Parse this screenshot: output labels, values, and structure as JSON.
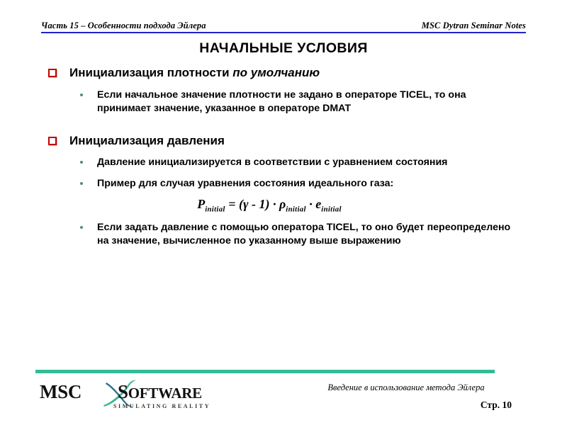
{
  "header": {
    "left": "Часть 15 – Особенности подхода Эйлера",
    "right": "MSC Dytran Seminar Notes",
    "rule_color": "#2222cc"
  },
  "title": "НАЧАЛЬНЫЕ УСЛОВИЯ",
  "bullets": {
    "b1": {
      "text_plain": "Инициализация плотности ",
      "text_italic": "по умолчанию",
      "marker_color": "#c00000",
      "sub": [
        {
          "text": "Если начальное значение плотности не задано в операторе TICEL, то она принимает значение, указанное в операторе DMAT"
        }
      ]
    },
    "b2": {
      "text_plain": "Инициализация давления",
      "text_italic": "",
      "marker_color": "#c00000",
      "sub": [
        {
          "text": "Давление инициализируется в соответствии с уравнением состояния"
        },
        {
          "text": "Пример для случая уравнения состояния идеального газа:"
        },
        {
          "text": "Если задать давление с помощью оператора TICEL, то оно будет переопределено на значение, вычисленное по указанному выше выражению"
        }
      ]
    }
  },
  "formula": {
    "lhs_var": "P",
    "lhs_sub": "initial",
    "equals": " = (",
    "gamma": "γ",
    "minus_one": " - 1) · ",
    "rho": "ρ",
    "rho_sub": "initial",
    "dot": " · ",
    "e_var": "e",
    "e_sub": "initial",
    "full": "P initial = (γ - 1) · ρ initial · e initial"
  },
  "footer": {
    "rule_color": "#33bb99",
    "logo_msc": "MSC",
    "logo_software_cap": "S",
    "logo_software_rest": "OFTWARE",
    "logo_tagline": "SIMULATING REALITY",
    "subtitle": "Введение в использование метода Эйлера",
    "page": "Стр. 10"
  }
}
